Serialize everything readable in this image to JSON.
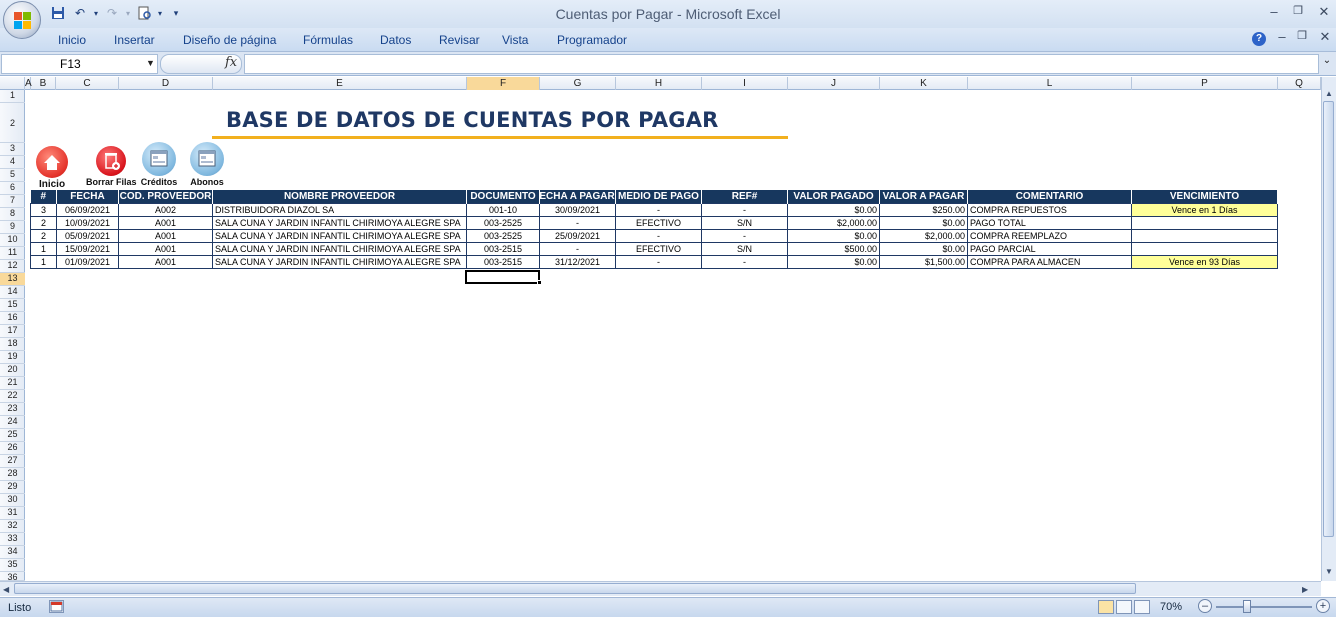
{
  "window": {
    "title": "Cuentas por Pagar - Microsoft Excel"
  },
  "ribbon_tabs": [
    "Inicio",
    "Insertar",
    "Diseño de página",
    "Fórmulas",
    "Datos",
    "Revisar",
    "Vista",
    "Programador"
  ],
  "formula_bar": {
    "name_box": "F13",
    "fx": "fx",
    "value": ""
  },
  "columns": [
    "A",
    "B",
    "C",
    "D",
    "E",
    "F",
    "G",
    "H",
    "I",
    "J",
    "K",
    "L",
    "P",
    "Q"
  ],
  "selected_column": "F",
  "rows": [
    "1",
    "2",
    "3",
    "4",
    "5",
    "6",
    "7",
    "8",
    "9",
    "10",
    "11",
    "12",
    "13",
    "14",
    "15",
    "16",
    "17",
    "18",
    "19",
    "20",
    "21",
    "22",
    "23",
    "24",
    "25",
    "26",
    "27",
    "28",
    "29",
    "30",
    "31",
    "32",
    "33",
    "34",
    "35",
    "36"
  ],
  "selected_row": "13",
  "sheet": {
    "title": "BASE DE DATOS DE CUENTAS POR PAGAR",
    "buttons": [
      {
        "label": "Inicio",
        "icon": "home-icon"
      },
      {
        "label": "Borrar Filas",
        "icon": "trash-icon"
      },
      {
        "label": "Créditos",
        "icon": "form-icon"
      },
      {
        "label": "Abonos",
        "icon": "form-icon"
      }
    ],
    "headers": [
      "#",
      "FECHA",
      "COD. PROVEEDOR",
      "NOMBRE PROVEEDOR",
      "DOCUMENTO",
      "FECHA A PAGAR",
      "MEDIO DE PAGO",
      "REF#",
      "VALOR PAGADO",
      "VALOR A PAGAR",
      "COMENTARIO",
      "VENCIMIENTO"
    ],
    "rows": [
      [
        "3",
        "06/09/2021",
        "A002",
        "DISTRIBUIDORA DIAZOL SA",
        "001-10",
        "30/09/2021",
        "-",
        "-",
        "$0.00",
        "$250.00",
        "COMPRA REPUESTOS",
        "Vence en 1 Días"
      ],
      [
        "2",
        "10/09/2021",
        "A001",
        "SALA CUNA Y JARDIN INFANTIL CHIRIMOYA ALEGRE SPA",
        "003-2525",
        "-",
        "EFECTIVO",
        "S/N",
        "$2,000.00",
        "$0.00",
        "PAGO TOTAL",
        ""
      ],
      [
        "2",
        "05/09/2021",
        "A001",
        "SALA CUNA Y JARDIN INFANTIL CHIRIMOYA ALEGRE SPA",
        "003-2525",
        "25/09/2021",
        "-",
        "-",
        "$0.00",
        "$2,000.00",
        "COMPRA REEMPLAZO",
        ""
      ],
      [
        "1",
        "15/09/2021",
        "A001",
        "SALA CUNA Y JARDIN INFANTIL CHIRIMOYA ALEGRE SPA",
        "003-2515",
        "-",
        "EFECTIVO",
        "S/N",
        "$500.00",
        "$0.00",
        "PAGO PARCIAL",
        ""
      ],
      [
        "1",
        "01/09/2021",
        "A001",
        "SALA CUNA Y JARDIN INFANTIL CHIRIMOYA ALEGRE SPA",
        "003-2515",
        "31/12/2021",
        "-",
        "-",
        "$0.00",
        "$1,500.00",
        "COMPRA PARA ALMACEN",
        "Vence en 93 Días"
      ]
    ]
  },
  "status": {
    "text": "Listo",
    "zoom": "70%"
  },
  "colors": {
    "header_bg": "#17375e",
    "title": "#1f3864",
    "accent_line": "#f2b01e",
    "due_highlight": "#ffff99"
  }
}
